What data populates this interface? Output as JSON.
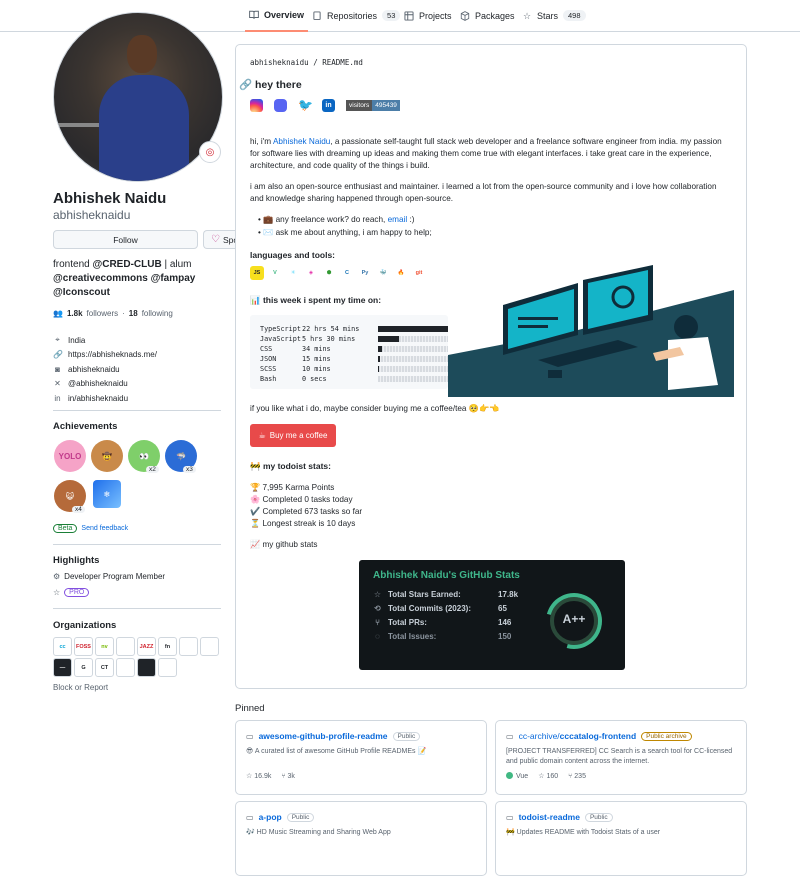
{
  "nav": {
    "tabs": [
      {
        "label": "Overview",
        "icon": "book-icon"
      },
      {
        "label": "Repositories",
        "icon": "repo-icon",
        "count": "53"
      },
      {
        "label": "Projects",
        "icon": "table-icon"
      },
      {
        "label": "Packages",
        "icon": "package-icon"
      },
      {
        "label": "Stars",
        "icon": "star-icon",
        "count": "498"
      }
    ]
  },
  "profile": {
    "name": "Abhishek Naidu",
    "login": "abhisheknaidu",
    "follow_label": "Follow",
    "sponsor_label": "Sponsor",
    "bio_prefix": "frontend ",
    "bio_cred": "@CRED-CLUB",
    "bio_mid": " | alum ",
    "bio_orgs": "@creativecommons @fampay @Iconscout",
    "followers_count": "1.8k",
    "followers_label": "followers",
    "following_count": "18",
    "following_label": "following",
    "details": [
      {
        "icon": "location-icon",
        "text": "India"
      },
      {
        "icon": "link-icon",
        "text": "https://abhisheknads.me/"
      },
      {
        "icon": "instagram-icon",
        "text": "abhisheknaidu"
      },
      {
        "icon": "twitter-icon",
        "text": "@abhisheknaidu"
      },
      {
        "icon": "linkedin-icon",
        "text": "in/abhisheknaidu"
      }
    ]
  },
  "achievements": {
    "title": "Achievements",
    "items": [
      {
        "name": "yolo",
        "label": "YOLO",
        "color": "#f5a3c7"
      },
      {
        "name": "quickdraw",
        "label": "",
        "color": "#c98a4a"
      },
      {
        "name": "pair-extraordinaire",
        "label": "",
        "color": "#7fcf6a",
        "count": "x2"
      },
      {
        "name": "pull-shark",
        "label": "",
        "color": "#2b6cd6",
        "count": "x3"
      },
      {
        "name": "starstruck",
        "label": "",
        "color": "#b56a3a",
        "count": "x4"
      },
      {
        "name": "arctic-code-vault",
        "label": "",
        "color": "#1f6feb"
      }
    ],
    "beta_label": "Beta",
    "feedback_label": "Send feedback"
  },
  "highlights": {
    "title": "Highlights",
    "items": [
      {
        "text": "Developer Program Member"
      },
      {
        "text": "PRO"
      }
    ]
  },
  "organizations": {
    "title": "Organizations",
    "items": [
      {
        "label": "cc",
        "color": "#0aa6d6"
      },
      {
        "label": "FOSS",
        "color": "#cf222e"
      },
      {
        "label": "nv",
        "color": "#76b900"
      },
      {
        "label": "",
        "color": "#3fb68b"
      },
      {
        "label": "JAZZ",
        "color": "#d1242f"
      },
      {
        "label": "fn",
        "color": "#1f2328"
      },
      {
        "label": "",
        "color": "#c9d1d9"
      },
      {
        "label": "",
        "color": "#f28f2c"
      },
      {
        "label": "—",
        "color": "#1f2328"
      },
      {
        "label": "G",
        "color": "#1f2328"
      },
      {
        "label": "CT",
        "color": "#1f2328"
      },
      {
        "label": "",
        "color": "#f28f2c"
      },
      {
        "label": "",
        "color": "#1f2328"
      },
      {
        "label": "",
        "color": "#1f2328"
      }
    ],
    "block_label": "Block or Report"
  },
  "readme": {
    "path_user": "abhisheknaidu",
    "path_file": "README.md",
    "heading": "hey there",
    "visitors_label": "visitors",
    "visitors_count": "495439",
    "intro_pre": "hi, i'm ",
    "intro_link": "Abhishek Naidu",
    "intro_post": ", a passionate self-taught full stack web developer and a freelance software engineer from india. my passion for software lies with dreaming up ideas and making them come true with elegant interfaces. i take great care in the experience, architecture, and code quality of the things i build.",
    "oss_para": "i am also an open-source enthusiast and maintainer. i learned a lot from the open-source community and i love how collaboration and knowledge sharing happened through open-source.",
    "bullet1_pre": "💼 any freelance work? do reach, ",
    "bullet1_link": "email",
    "bullet1_post": " :)",
    "bullet2": "✉️ ask me about anything, i am happy to help;",
    "tools_heading": "languages and tools:",
    "tools": [
      {
        "label": "JS",
        "color": "#f7df1e",
        "fg": "#1f2328"
      },
      {
        "label": "V",
        "color": "#ffffff",
        "fg": "#41b883"
      },
      {
        "label": "✳",
        "color": "#ffffff",
        "fg": "#61dafb"
      },
      {
        "label": "◈",
        "color": "#ffffff",
        "fg": "#e535ab"
      },
      {
        "label": "⬢",
        "color": "#ffffff",
        "fg": "#339933"
      },
      {
        "label": "C",
        "color": "#ffffff",
        "fg": "#1572b6"
      },
      {
        "label": "Py",
        "color": "#ffffff",
        "fg": "#3776ab"
      },
      {
        "label": "🐳",
        "color": "#ffffff",
        "fg": "#2496ed"
      },
      {
        "label": "🔥",
        "color": "#ffffff",
        "fg": "#ffca28"
      },
      {
        "label": "git",
        "color": "#ffffff",
        "fg": "#f05032"
      }
    ],
    "week_heading": "📊 this week i spent my time on:",
    "wakatime": [
      {
        "lang": "TypeScript",
        "time": "22 hrs 54 mins",
        "pct": 100
      },
      {
        "lang": "JavaScript",
        "time": "5 hrs 30 mins",
        "pct": 30
      },
      {
        "lang": "CSS",
        "time": "34 mins",
        "pct": 6
      },
      {
        "lang": "JSON",
        "time": "15 mins",
        "pct": 3
      },
      {
        "lang": "SCSS",
        "time": "10 mins",
        "pct": 2
      },
      {
        "lang": "Bash",
        "time": "0 secs",
        "pct": 0
      }
    ],
    "coffee_text": "if you like what i do, maybe consider buying me a coffee/tea 🥺👉👈",
    "coffee_button": "Buy me a coffee",
    "todoist_heading": "🚧 my todoist stats:",
    "todoist": [
      "🏆 7,995 Karma Points",
      "🌸 Completed 0 tasks today",
      "✔️ Completed 673 tasks so far",
      "⏳ Longest streak is 10 days"
    ],
    "gh_stats_heading": "📈 my github stats",
    "gh_card": {
      "title": "Abhishek Naidu's GitHub Stats",
      "rows": [
        {
          "icon": "star-icon",
          "label": "Total Stars Earned:",
          "value": "17.8k"
        },
        {
          "icon": "history-icon",
          "label": "Total Commits (2023):",
          "value": "65"
        },
        {
          "icon": "pull-request-icon",
          "label": "Total PRs:",
          "value": "146"
        },
        {
          "icon": "issue-icon",
          "label": "Total Issues:",
          "value": "150"
        }
      ],
      "grade": "A++",
      "accent": "#3fb68b"
    }
  },
  "pinned": {
    "title": "Pinned",
    "items": [
      {
        "owner": "",
        "name": "awesome-github-profile-readme",
        "visibility": "Public",
        "desc": "😎 A curated list of awesome GitHub Profile READMEs 📝",
        "lang": "",
        "stars": "16.9k",
        "forks": "3k"
      },
      {
        "owner": "cc-archive/",
        "name": "cccatalog-frontend",
        "visibility": "Public archive",
        "desc": "[PROJECT TRANSFERRED] CC Search is a search tool for CC-licensed and public domain content across the internet.",
        "lang": "Vue",
        "stars": "160",
        "forks": "235"
      },
      {
        "owner": "",
        "name": "a-pop",
        "visibility": "Public",
        "desc": "🎶 HD Music Streaming and Sharing Web App",
        "lang": "",
        "stars": "",
        "forks": ""
      },
      {
        "owner": "",
        "name": "todoist-readme",
        "visibility": "Public",
        "desc": "🚧 Updates README with Todoist Stats of a user",
        "lang": "",
        "stars": "",
        "forks": ""
      }
    ]
  }
}
